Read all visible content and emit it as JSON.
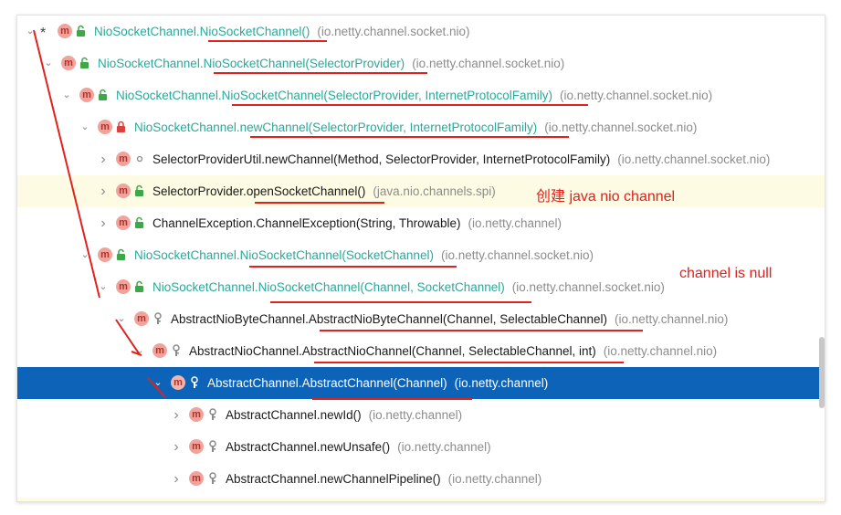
{
  "rows": [
    {
      "indent": 0,
      "chevron": "expanded",
      "star": true,
      "icon": "method-icon",
      "vis": "public",
      "cls": "NioSocketChannel.",
      "method": "NioSocketChannel()",
      "pkg": "(io.netty.channel.socket.nio)",
      "teal": true
    },
    {
      "indent": 1,
      "chevron": "expanded",
      "icon": "method-icon",
      "vis": "public",
      "cls": "NioSocketChannel.",
      "method": "NioSocketChannel(SelectorProvider)",
      "pkg": "(io.netty.channel.socket.nio)",
      "teal": true
    },
    {
      "indent": 2,
      "chevron": "expanded",
      "icon": "method-icon",
      "vis": "public",
      "cls": "NioSocketChannel.",
      "method": "NioSocketChannel(SelectorProvider, InternetProtocolFamily)",
      "pkg": "(io.netty.channel.socket.nio)",
      "teal": true
    },
    {
      "indent": 3,
      "chevron": "expanded",
      "icon": "method-icon",
      "vis": "private",
      "cls": "NioSocketChannel.",
      "method": "newChannel(SelectorProvider, InternetProtocolFamily)",
      "pkg": "(io.netty.channel.socket.nio)",
      "teal": true
    },
    {
      "indent": 4,
      "chevron": "collapsed",
      "icon": "method-icon",
      "vis": "package",
      "cls": "SelectorProviderUtil.",
      "method": "newChannel(Method, SelectorProvider, InternetProtocolFamily)",
      "pkg": "(io.netty.channel.socket.nio)",
      "teal": false
    },
    {
      "indent": 4,
      "chevron": "collapsed",
      "icon": "method-icon",
      "vis": "public",
      "cls": "SelectorProvider.",
      "method": "openSocketChannel()",
      "pkg": "(java.nio.channels.spi)",
      "teal": false,
      "highlight": true
    },
    {
      "indent": 4,
      "chevron": "collapsed",
      "icon": "method-icon",
      "vis": "public",
      "cls": "ChannelException.",
      "method": "ChannelException(String, Throwable)",
      "pkg": "(io.netty.channel)",
      "teal": false
    },
    {
      "indent": 3,
      "chevron": "expanded",
      "icon": "method-icon",
      "vis": "public",
      "cls": "NioSocketChannel.",
      "method": "NioSocketChannel(SocketChannel)",
      "pkg": "(io.netty.channel.socket.nio)",
      "teal": true
    },
    {
      "indent": 4,
      "chevron": "expanded",
      "icon": "method-icon",
      "vis": "public",
      "cls": "NioSocketChannel.",
      "method": "NioSocketChannel(Channel, SocketChannel)",
      "pkg": "(io.netty.channel.socket.nio)",
      "teal": true
    },
    {
      "indent": 5,
      "chevron": "expanded",
      "icon": "method-icon",
      "vis": "protected",
      "cls": "AbstractNioByteChannel.",
      "method": "AbstractNioByteChannel(Channel, SelectableChannel)",
      "pkg": "(io.netty.channel.nio)",
      "teal": false
    },
    {
      "indent": 6,
      "chevron": "expanded",
      "icon": "method-icon",
      "vis": "protected",
      "cls": "AbstractNioChannel.",
      "method": "AbstractNioChannel(Channel, SelectableChannel, int)",
      "pkg": "(io.netty.channel.nio)",
      "teal": false
    },
    {
      "indent": 7,
      "chevron": "expanded",
      "icon": "method-icon",
      "vis": "protected",
      "cls": "AbstractChannel.",
      "method": "AbstractChannel(Channel)",
      "pkg": "(io.netty.channel)",
      "teal": false,
      "selected": true
    },
    {
      "indent": 8,
      "chevron": "collapsed",
      "icon": "method-icon",
      "vis": "protected",
      "cls": "AbstractChannel.",
      "method": "newId()",
      "pkg": "(io.netty.channel)",
      "teal": false
    },
    {
      "indent": 8,
      "chevron": "collapsed",
      "icon": "method-icon",
      "vis": "protected",
      "cls": "AbstractChannel.",
      "method": "newUnsafe()",
      "pkg": "(io.netty.channel)",
      "teal": false
    },
    {
      "indent": 8,
      "chevron": "collapsed",
      "icon": "method-icon",
      "vis": "protected",
      "cls": "AbstractChannel.",
      "method": "newChannelPipeline()",
      "pkg": "(io.netty.channel)",
      "teal": false
    }
  ],
  "icon_letter": "m",
  "annotations": {
    "create_channel": "创建 java nio channel",
    "channel_null": "channel is null"
  },
  "colors": {
    "teal_text": "#2aa89a",
    "selected_bg": "#0d63b8",
    "highlight_bg": "#fdfbe3",
    "annotation_red": "#e0221f"
  }
}
